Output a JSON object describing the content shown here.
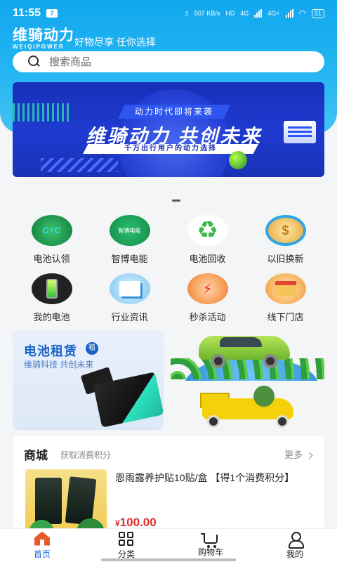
{
  "status_bar": {
    "time": "11:55",
    "app_badge": "7",
    "network_speed": "507 KB/s",
    "hd_label": "HD",
    "sim1": "4G",
    "sim2": "4G+",
    "battery": "51"
  },
  "brand": {
    "title": "维骑动力",
    "subtitle": "WEIQIPOWER",
    "slogan": "好物尽享 任你选择"
  },
  "search": {
    "placeholder": "搜索商品"
  },
  "banner": {
    "tag": "动力时代即将来袭",
    "title": "维骑动力  共创未来",
    "subtitle": "千万出行用户的动力选择"
  },
  "menu": {
    "items": [
      {
        "label": "电池认领",
        "icon": "battery-claim-icon"
      },
      {
        "label": "智博电能",
        "icon": "zhibo-energy-icon",
        "icon_text": "智博电能"
      },
      {
        "label": "电池回收",
        "icon": "recycle-icon"
      },
      {
        "label": "以旧换新",
        "icon": "trade-in-icon"
      },
      {
        "label": "我的电池",
        "icon": "my-battery-icon"
      },
      {
        "label": "行业资讯",
        "icon": "news-icon"
      },
      {
        "label": "秒杀活动",
        "icon": "flash-sale-icon"
      },
      {
        "label": "线下门店",
        "icon": "store-icon"
      }
    ]
  },
  "rental": {
    "title": "电池租赁",
    "badge": "租",
    "subtitle": "维骑科技 共创未来"
  },
  "mall": {
    "title": "商城",
    "subtitle": "获取消费积分",
    "more": "更多",
    "product": {
      "name": "恩雨露养护贴10贴/盒 【得1个消费积分】",
      "currency": "¥",
      "price": "100.00"
    }
  },
  "tabbar": {
    "items": [
      {
        "label": "首页",
        "active": true
      },
      {
        "label": "分类",
        "active": false
      },
      {
        "label": "购物车",
        "active": false
      },
      {
        "label": "我的",
        "active": false
      }
    ]
  },
  "colors": {
    "header": "#11a7ee",
    "accent_blue": "#1f6ad8",
    "price_red": "#e02b2b",
    "home_orange": "#e8582b"
  }
}
